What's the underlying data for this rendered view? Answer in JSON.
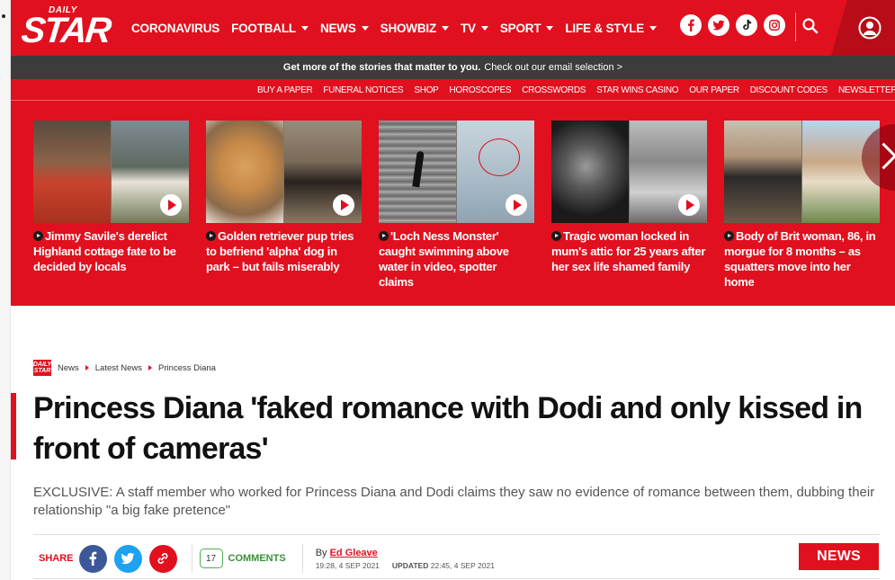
{
  "brand": {
    "daily": "DAILY",
    "star": "STAR",
    "mini": "DAILY STAR",
    "color": "#e0101e"
  },
  "nav": {
    "links": [
      {
        "label": "CORONAVIRUS",
        "dropdown": false
      },
      {
        "label": "FOOTBALL",
        "dropdown": true
      },
      {
        "label": "NEWS",
        "dropdown": true
      },
      {
        "label": "SHOWBIZ",
        "dropdown": true
      },
      {
        "label": "TV",
        "dropdown": true
      },
      {
        "label": "SPORT",
        "dropdown": true
      },
      {
        "label": "LIFE & STYLE",
        "dropdown": true
      }
    ],
    "socials": [
      "facebook-icon",
      "twitter-icon",
      "tiktok-icon",
      "instagram-icon"
    ]
  },
  "email_bar": {
    "bold": "Get more of the stories that matter to you.",
    "link": "Check out our email selection >"
  },
  "sublinks": [
    "BUY A PAPER",
    "FUNERAL NOTICES",
    "SHOP",
    "HOROSCOPES",
    "CROSSWORDS",
    "STAR WINS CASINO",
    "OUR PAPER",
    "DISCOUNT CODES",
    "NEWSLETTER SIGNUP"
  ],
  "cards": [
    {
      "title": "Jimmy Savile's derelict Highland cottage fate to be decided by locals"
    },
    {
      "title": "Golden retriever pup tries to befriend 'alpha' dog in park – but fails miserably"
    },
    {
      "title": "'Loch Ness Monster' caught swimming above water in video, spotter claims"
    },
    {
      "title": "Tragic woman locked in mum's attic for 25 years after her sex life shamed family"
    },
    {
      "title": "Body of Brit woman, 86, in morgue for 8 months – as squatters move into her home"
    }
  ],
  "breadcrumb": [
    "News",
    "Latest News",
    "Princess Diana"
  ],
  "article": {
    "headline": "Princess Diana 'faked romance with Dodi and only kissed in front of cameras'",
    "standfirst": "EXCLUSIVE: A staff member who worked for Princess Diana and Dodi claims they saw no evidence of romance between them, dubbing their relationship \"a big fake pretence\"",
    "share_label": "SHARE",
    "comments_count": "17",
    "comments_label": "COMMENTS",
    "by": "By",
    "author": "Ed Gleave",
    "published": "19:28, 4 SEP 2021",
    "updated_label": "UPDATED",
    "updated": "22:45, 4 SEP 2021",
    "section_button": "NEWS"
  },
  "colors": {
    "brand_red": "#e0101e",
    "dark_bar": "#3c3c3c",
    "facebook": "#3b5998",
    "twitter": "#1da1f2",
    "comments_green": "#4caf50"
  }
}
